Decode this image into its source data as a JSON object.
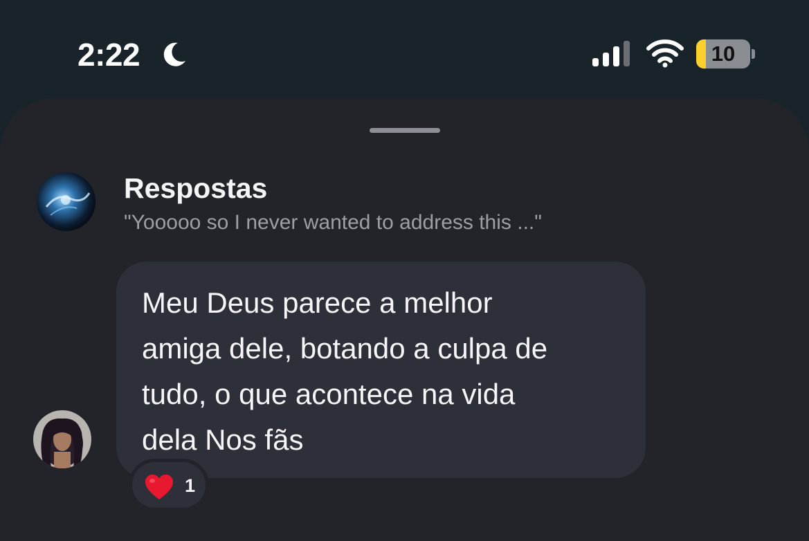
{
  "status_bar": {
    "time": "2:22",
    "battery_level": "10",
    "battery_fraction": 0.18,
    "focus_icon": "moon-icon",
    "signal_icon": "cellular-signal-icon",
    "wifi_icon": "wifi-icon"
  },
  "replies_sheet": {
    "title": "Respostas",
    "quoted_text": "\"Yooooo so I never wanted to address this ...\""
  },
  "message": {
    "text": "Meu Deus parece a melhor\namiga dele, botando a culpa de\ntudo, o que acontece na vida\ndela Nos fãs",
    "reaction": {
      "emoji_icon": "red-heart-icon",
      "count": "1"
    }
  },
  "colors": {
    "background": "#19232a",
    "sheet": "#222429",
    "bubble": "#2d3038",
    "subtitle": "#9c9fa6",
    "battery_accent": "#fcd02c",
    "heart": "#e8182f"
  }
}
